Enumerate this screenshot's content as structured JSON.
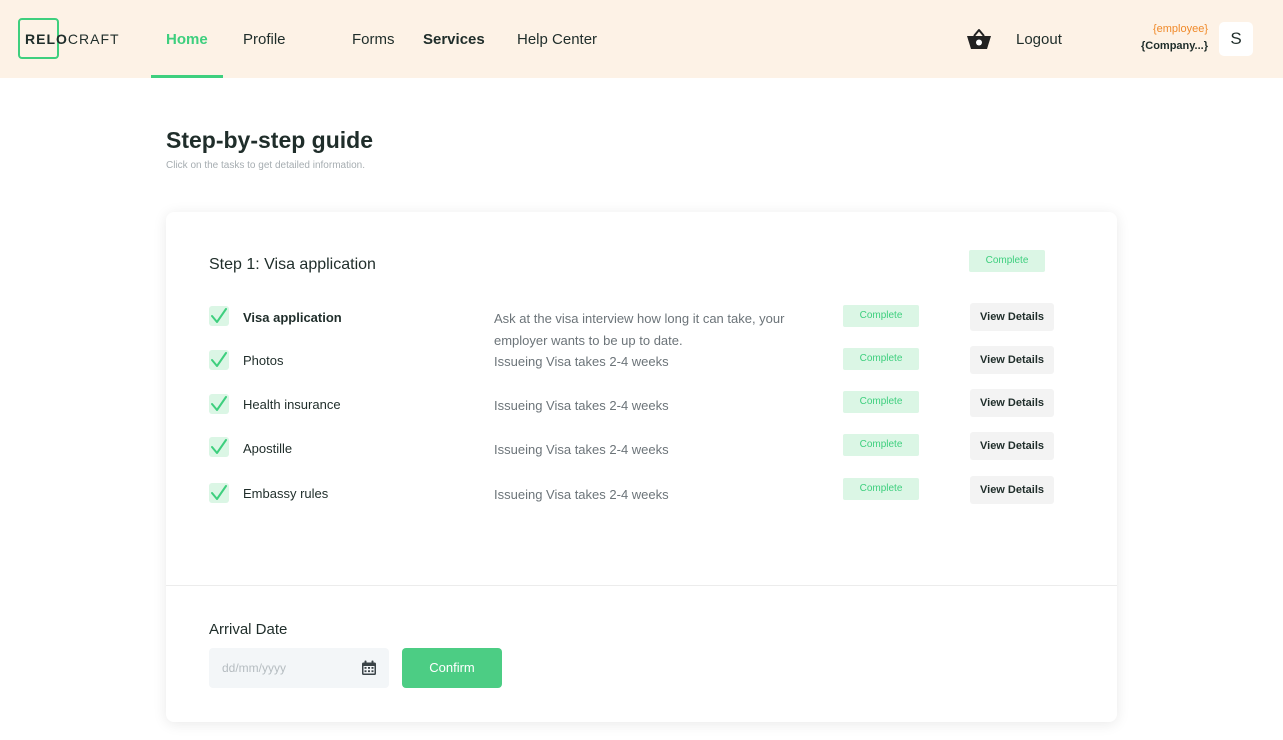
{
  "header": {
    "logo": {
      "part1": "RELO",
      "part2": "CRAFT"
    },
    "nav": [
      {
        "label": "Home"
      },
      {
        "label": "Profile"
      },
      {
        "label": "Forms"
      },
      {
        "label": "Services"
      },
      {
        "label": "Help Center"
      }
    ],
    "cart_icon": "shopping-basket-icon",
    "logout_label": "Logout",
    "user": {
      "role": "{employee}",
      "company": "{Company...}",
      "avatar_initial": "S"
    }
  },
  "page": {
    "title": "Step-by-step guide",
    "subtitle": "Click on the tasks to get detailed information."
  },
  "step": {
    "title": "Step 1: Visa application",
    "status": "Complete",
    "tasks": [
      {
        "name": "Visa application",
        "description": "Ask at the visa interview how long it can take, your employer wants to be up to date.",
        "status": "Complete",
        "action": "View Details"
      },
      {
        "name": "Photos",
        "description": "Issueing Visa takes 2-4 weeks",
        "status": "Complete",
        "action": "View Details"
      },
      {
        "name": "Health insurance",
        "description": "Issueing Visa takes 2-4 weeks",
        "status": "Complete",
        "action": "View Details"
      },
      {
        "name": "Apostille",
        "description": "Issueing Visa takes 2-4 weeks",
        "status": "Complete",
        "action": "View Details"
      },
      {
        "name": "Embassy rules",
        "description": "Issueing Visa takes 2-4 weeks",
        "status": "Complete",
        "action": "View Details"
      }
    ]
  },
  "arrival": {
    "label": "Arrival Date",
    "placeholder": "dd/mm/yyyy",
    "value": "",
    "confirm_label": "Confirm"
  },
  "colors": {
    "accent": "#3ecf7e",
    "header_bg": "#fdf2e6",
    "badge_bg": "#dbf6e5",
    "role_text": "#f08a2a"
  }
}
